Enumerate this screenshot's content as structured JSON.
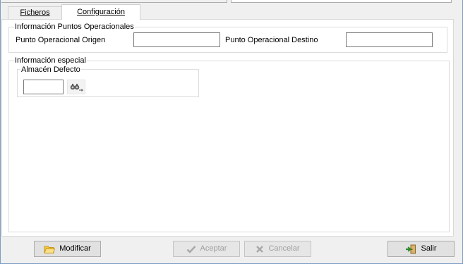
{
  "tabs": [
    {
      "label": "Ficheros",
      "active": false
    },
    {
      "label": "Configuración",
      "active": true
    }
  ],
  "puntos_operacionales": {
    "legend": "Información Puntos Operacionales",
    "origen_label": "Punto Operacional Origen",
    "origen_value": "",
    "destino_label": "Punto Operacional Destino",
    "destino_value": ""
  },
  "informacion_especial": {
    "legend": "Información especial",
    "almacen": {
      "legend": "Almacén Defecto",
      "value": ""
    }
  },
  "buttons": {
    "modificar": "Modificar",
    "aceptar": "Aceptar",
    "cancelar": "Cancelar",
    "salir": "Salir"
  }
}
